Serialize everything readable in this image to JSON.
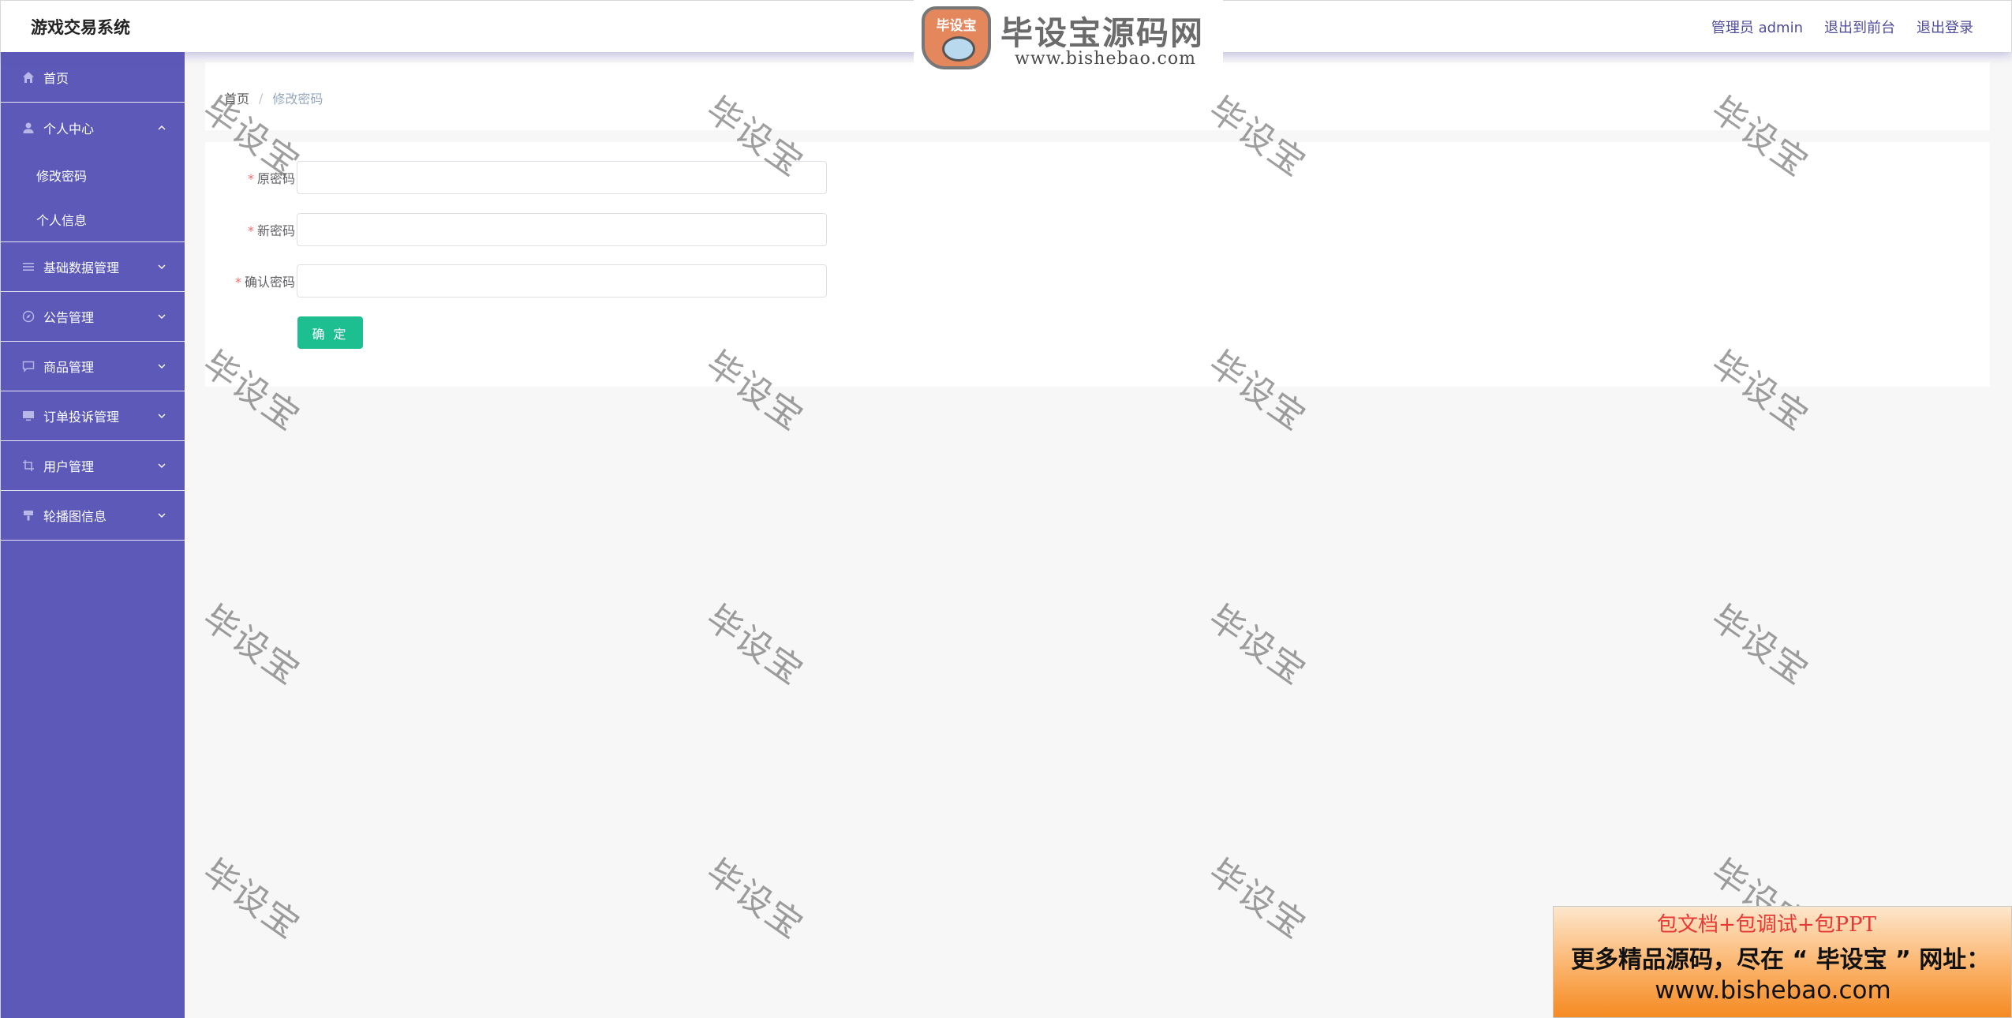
{
  "header": {
    "app_title": "游戏交易系统",
    "admin_label": "管理员 admin",
    "exit_front_label": "退出到前台",
    "logout_label": "退出登录"
  },
  "logo": {
    "badge_text": "毕设宝",
    "title": "毕设宝源码网",
    "url": "www.bishebao.com"
  },
  "sidebar": {
    "items": [
      {
        "label": "首页",
        "icon": "home-icon"
      },
      {
        "label": "个人中心",
        "icon": "user-icon",
        "expanded": true,
        "children": [
          {
            "label": "修改密码"
          },
          {
            "label": "个人信息"
          }
        ]
      },
      {
        "label": "基础数据管理",
        "icon": "list-icon"
      },
      {
        "label": "公告管理",
        "icon": "compass-icon"
      },
      {
        "label": "商品管理",
        "icon": "message-icon"
      },
      {
        "label": "订单投诉管理",
        "icon": "monitor-icon"
      },
      {
        "label": "用户管理",
        "icon": "crop-icon"
      },
      {
        "label": "轮播图信息",
        "icon": "brush-icon"
      }
    ]
  },
  "breadcrumb": {
    "home": "首页",
    "separator": "/",
    "current": "修改密码"
  },
  "form": {
    "fields": [
      {
        "label": "原密码",
        "required_mark": "*",
        "value": ""
      },
      {
        "label": "新密码",
        "required_mark": "*",
        "value": ""
      },
      {
        "label": "确认密码",
        "required_mark": "*",
        "value": ""
      }
    ],
    "submit_label": "确 定"
  },
  "watermark_text": "毕设宝",
  "ad": {
    "line1": "包文档+包调试+包PPT",
    "line2": "更多精品源码，尽在 “ 毕设宝 ” 网址：",
    "line3": "www.bishebao.com"
  },
  "colors": {
    "sidebar_bg": "#5c59b8",
    "accent_button": "#1dbf91",
    "header_link": "#4f4c9a",
    "required_mark": "#f56c6c"
  }
}
